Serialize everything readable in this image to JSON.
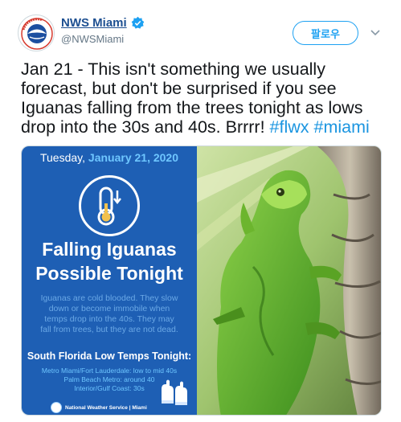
{
  "account": {
    "display_name": "NWS Miami",
    "handle": "@NWSMiami",
    "verified": true
  },
  "actions": {
    "follow_label": "팔로우"
  },
  "tweet": {
    "line1": "Jan 21 - This isn't something we usually",
    "line2": "forecast, but don't be surprised if you see",
    "line3": "Iguanas falling from the trees tonight as lows",
    "line4_text": "drop into the 30s and 40s. Brrrr! ",
    "hashtag1": "#flwx",
    "hashtag2": "#miami"
  },
  "graphic": {
    "weekday": "Tuesday,",
    "date": "January 21, 2020",
    "headline_line1": "Falling Iguanas",
    "headline_line2": "Possible Tonight",
    "desc_line1": "Iguanas are cold blooded. They slow",
    "desc_line2": "down or become immobile when",
    "desc_line3": "temps drop into the 40s. They may",
    "desc_line4": "fall from trees, but they are not dead.",
    "low_heading": "South Florida Low Temps Tonight:",
    "low1": "Metro Miami/Fort Lauderdale: low to mid 40s",
    "low2": "Palm Beach Metro: around 40",
    "low3": "Interior/Gulf Coast: 30s",
    "footer": "National Weather Service | Miami"
  },
  "icons": {
    "avatar": "nws-logo-icon",
    "verified": "verified-badge-icon",
    "more": "chevron-down-icon",
    "thermometer": "thermometer-icon",
    "gloves": "gloves-icon"
  },
  "colors": {
    "link": "#1b95e0",
    "panel_bg": "#1e5fb4",
    "accent": "#6ec6ff"
  }
}
